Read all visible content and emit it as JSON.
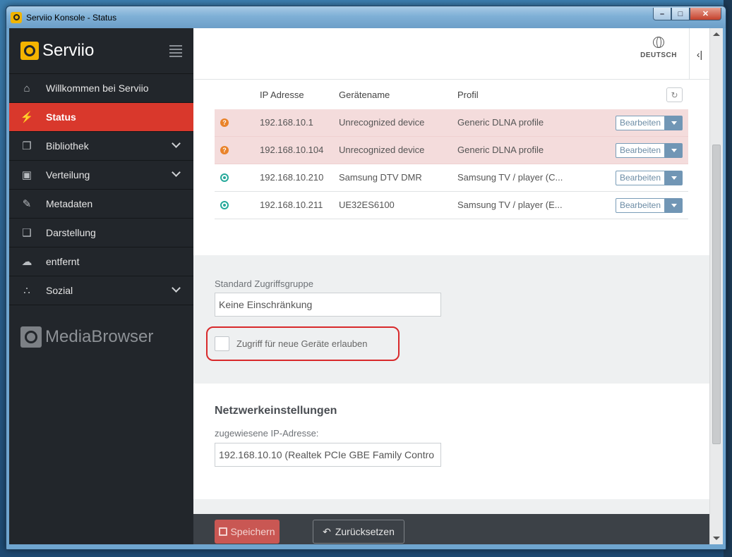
{
  "window": {
    "title": "Serviio Konsole - Status",
    "controls": {
      "minimize": "–",
      "maximize": "□",
      "close": "✕"
    }
  },
  "sidebar": {
    "brand": "Serviio",
    "items": [
      {
        "label": "Willkommen bei Serviio",
        "icon": "home-icon",
        "glyph": "⌂",
        "active": false,
        "expandable": false
      },
      {
        "label": "Status",
        "icon": "plug-icon",
        "glyph": "⚡",
        "active": true,
        "expandable": false
      },
      {
        "label": "Bibliothek",
        "icon": "library-icon",
        "glyph": "❐",
        "active": false,
        "expandable": true
      },
      {
        "label": "Verteilung",
        "icon": "cube-icon",
        "glyph": "▣",
        "active": false,
        "expandable": true
      },
      {
        "label": "Metadaten",
        "icon": "edit-icon",
        "glyph": "✎",
        "active": false,
        "expandable": false
      },
      {
        "label": "Darstellung",
        "icon": "display-icon",
        "glyph": "❑",
        "active": false,
        "expandable": false
      },
      {
        "label": "entfernt",
        "icon": "cloud-icon",
        "glyph": "☁",
        "active": false,
        "expandable": false
      },
      {
        "label": "Sozial",
        "icon": "share-icon",
        "glyph": "∴",
        "active": false,
        "expandable": true
      }
    ],
    "footer_brand": "MediaBrowser"
  },
  "topbar": {
    "language": "DEUTSCH"
  },
  "devices": {
    "headers": {
      "ip": "IP Adresse",
      "name": "Gerätename",
      "profile": "Profil"
    },
    "edit_label": "Bearbeiten",
    "rows": [
      {
        "status": "unknown",
        "ip": "192.168.10.1",
        "name": "Unrecognized device",
        "profile": "Generic DLNA profile"
      },
      {
        "status": "unknown",
        "ip": "192.168.10.104",
        "name": "Unrecognized device",
        "profile": "Generic DLNA profile"
      },
      {
        "status": "active",
        "ip": "192.168.10.210",
        "name": "Samsung DTV DMR",
        "profile": "Samsung TV / player (C..."
      },
      {
        "status": "active",
        "ip": "192.168.10.211",
        "name": "UE32ES6100",
        "profile": "Samsung TV / player (E..."
      }
    ]
  },
  "access": {
    "group_label": "Standard Zugriffsgruppe",
    "group_value": "Keine Einschränkung",
    "allow_new_label": "Zugriff für neue Geräte erlauben",
    "allow_new_checked": false
  },
  "network": {
    "title": "Netzwerkeinstellungen",
    "ip_label": "zugewiesene IP-Adresse:",
    "ip_value": "192.168.10.10 (Realtek PCIe GBE Family Contro"
  },
  "footer": {
    "save": "Speichern",
    "reset": "Zurücksetzen"
  }
}
